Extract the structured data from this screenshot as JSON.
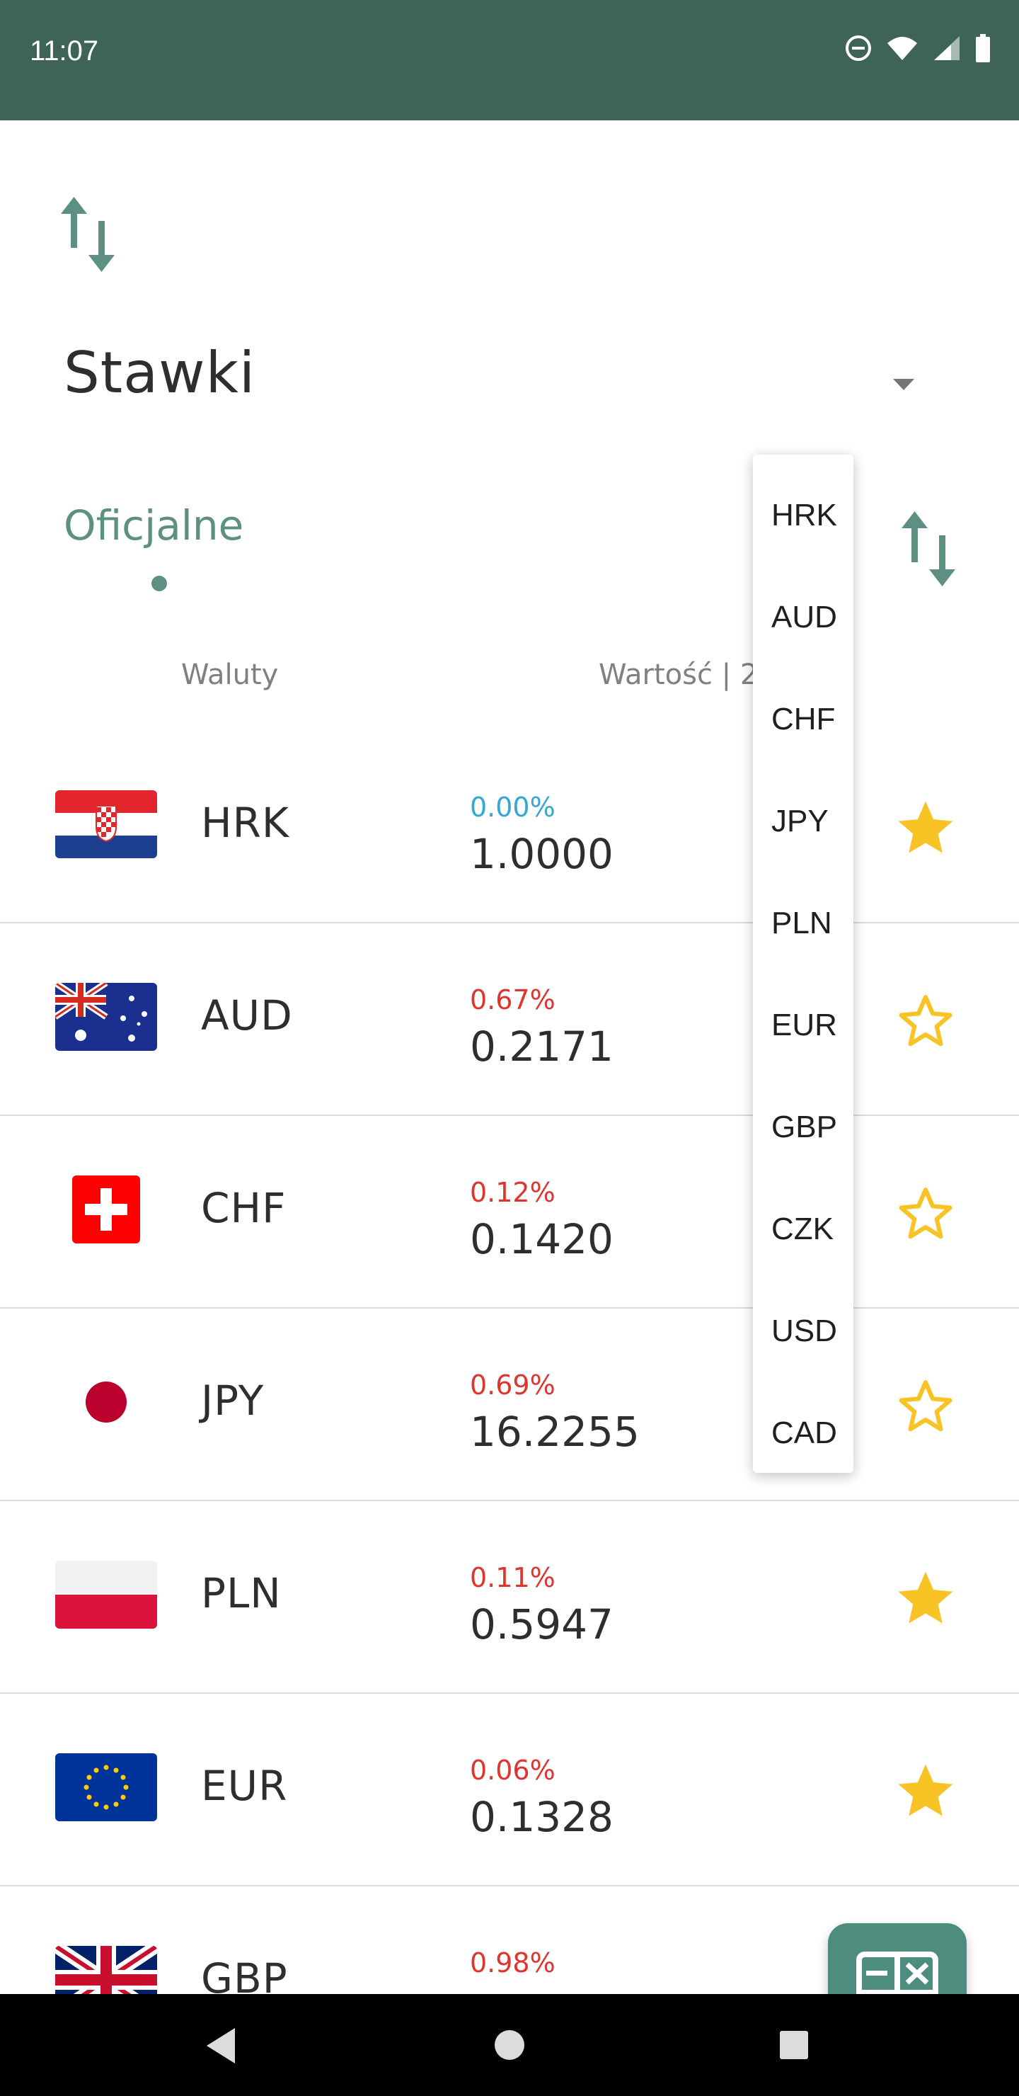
{
  "status_bar": {
    "time": "11:07",
    "icons": [
      "do-not-disturb-icon",
      "wifi-icon",
      "signal-icon",
      "battery-icon"
    ]
  },
  "header": {
    "title": "Stawki",
    "swap_icon": "swap-vertical-icon"
  },
  "base_currency_select": {
    "options": [
      "HRK",
      "AUD",
      "CHF",
      "JPY",
      "PLN",
      "EUR",
      "GBP",
      "CZK",
      "USD",
      "CAD"
    ]
  },
  "tabs": [
    {
      "label": "Oficjalne",
      "active": true
    }
  ],
  "columns": {
    "currency": "Waluty",
    "value": "Wartość | 2"
  },
  "rates": [
    {
      "code": "HRK",
      "flag": "croatia-flag",
      "change": "0.00%",
      "trend": "neutral",
      "value": "1.0000",
      "favorite": true
    },
    {
      "code": "AUD",
      "flag": "australia-flag",
      "change": "0.67%",
      "trend": "down",
      "value": "0.2171",
      "favorite": false
    },
    {
      "code": "CHF",
      "flag": "switzerland-flag",
      "change": "0.12%",
      "trend": "down",
      "value": "0.1420",
      "favorite": false
    },
    {
      "code": "JPY",
      "flag": "japan-flag",
      "change": "0.69%",
      "trend": "down",
      "value": "16.2255",
      "favorite": false
    },
    {
      "code": "PLN",
      "flag": "poland-flag",
      "change": "0.11%",
      "trend": "down",
      "value": "0.5947",
      "favorite": true
    },
    {
      "code": "EUR",
      "flag": "eu-flag",
      "change": "0.06%",
      "trend": "down",
      "value": "0.1328",
      "favorite": true
    },
    {
      "code": "GBP",
      "flag": "uk-flag",
      "change": "0.98%",
      "trend": "down",
      "value": "",
      "favorite": false
    }
  ],
  "fab": {
    "icon": "calculator-icon"
  },
  "colors": {
    "status_bar": "#3e6358",
    "accent": "#5d8f83",
    "fab": "#4e8c7e",
    "star": "#f7c325",
    "change_down": "#e0352f",
    "change_neutral": "#35a7d3"
  },
  "nav_bar": {
    "icons": [
      "back-icon",
      "home-icon",
      "recents-icon"
    ]
  }
}
